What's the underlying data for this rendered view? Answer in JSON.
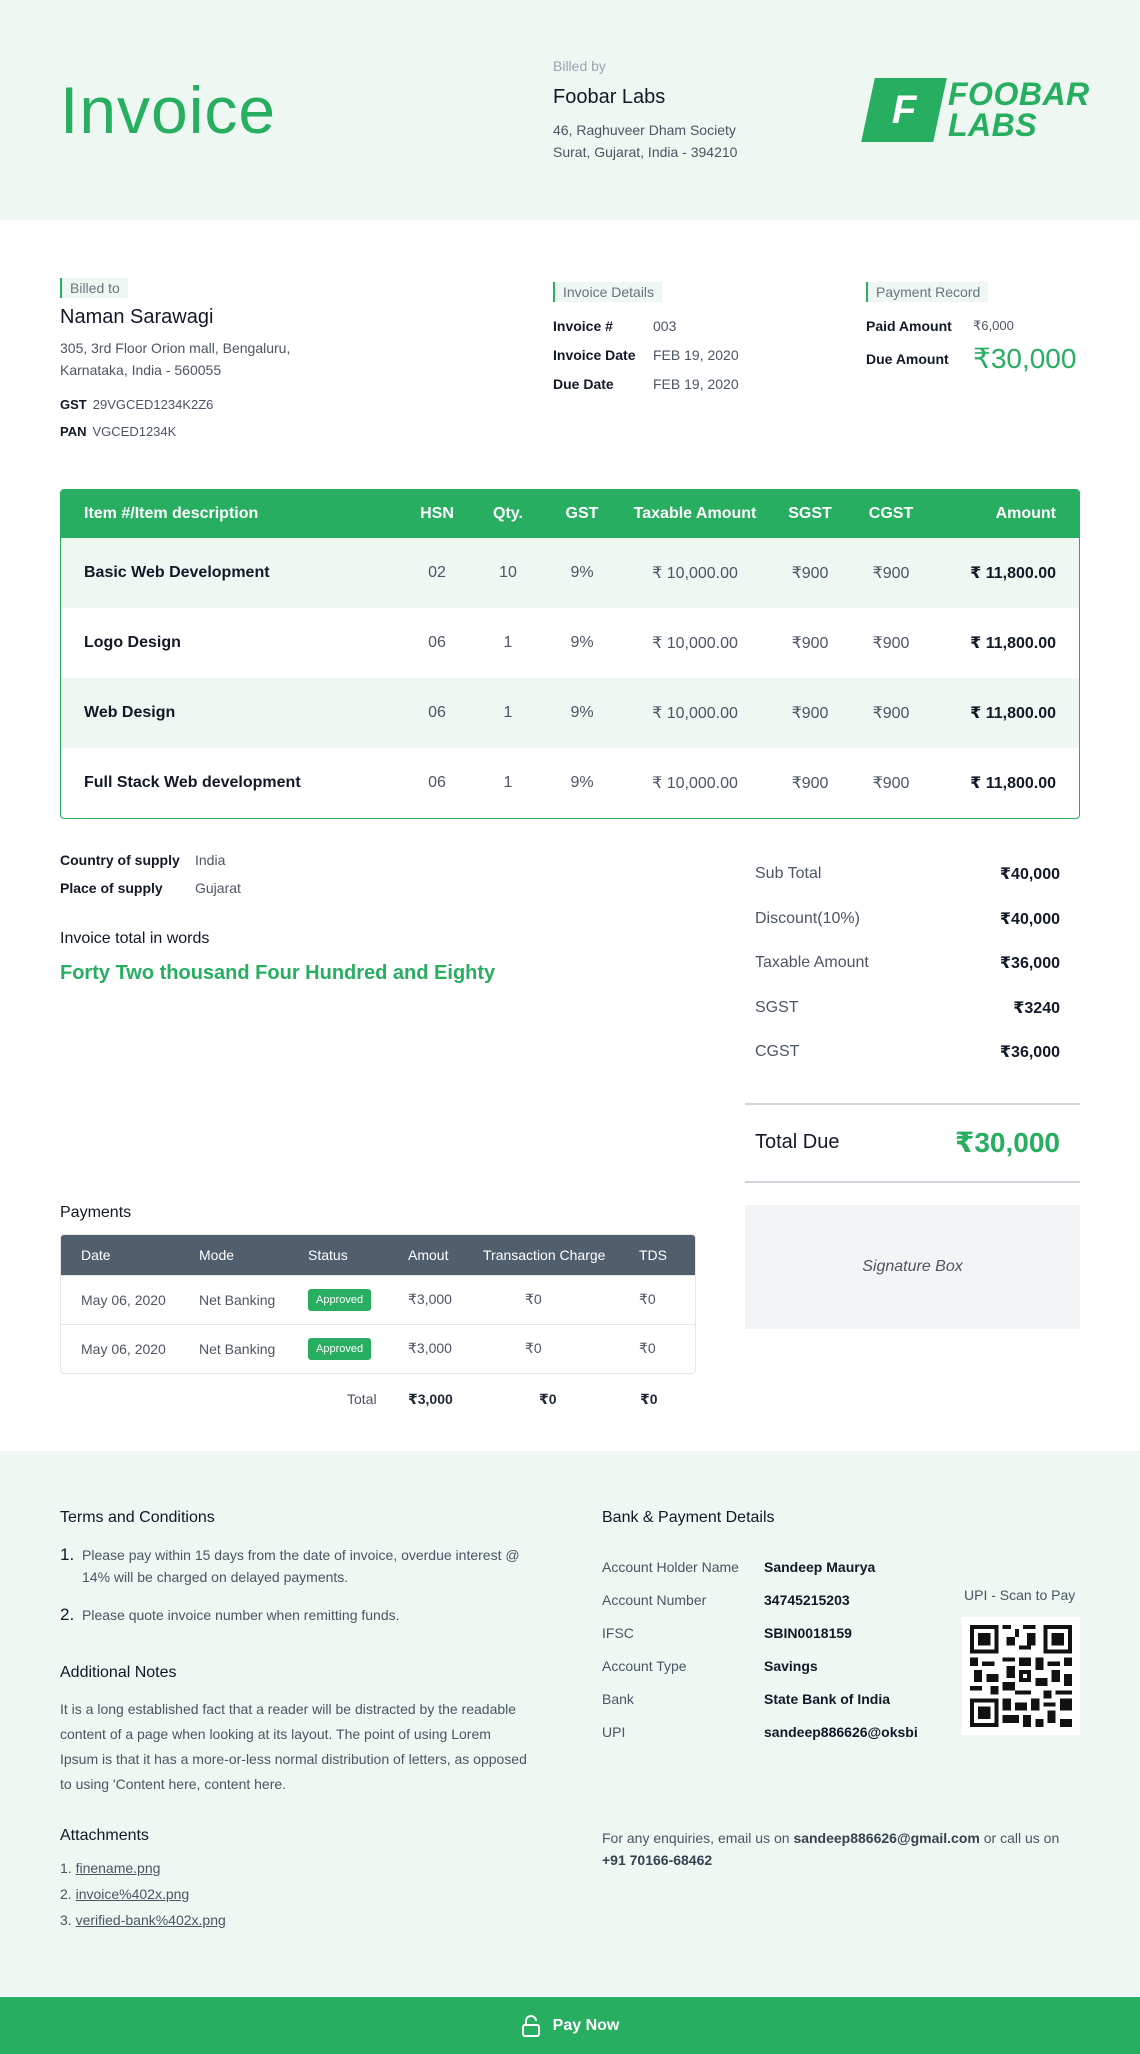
{
  "header": {
    "title": "Invoice",
    "billed_by_label": "Billed by",
    "company": "Foobar Labs",
    "address_line1": "46, Raghuveer Dham Society",
    "address_line2": "Surat, Gujarat, India - 394210",
    "logo_mark": "F",
    "logo_line1": "FOOBAR",
    "logo_line2": "LABS"
  },
  "billed_to": {
    "label": "Billed to",
    "name": "Naman Sarawagi",
    "address_line1": "305, 3rd Floor Orion mall, Bengaluru,",
    "address_line2": "Karnataka, India - 560055",
    "gst_label": "GST",
    "gst": "29VGCED1234K2Z6",
    "pan_label": "PAN",
    "pan": "VGCED1234K"
  },
  "invoice_details": {
    "label": "Invoice Details",
    "number_label": "Invoice #",
    "number": "003",
    "date_label": "Invoice Date",
    "date": "FEB 19, 2020",
    "due_label": "Due Date",
    "due": "FEB 19, 2020"
  },
  "payment_record": {
    "label": "Payment Record",
    "paid_label": "Paid Amount",
    "paid": "₹6,000",
    "due_label": "Due Amount",
    "due": "₹30,000"
  },
  "items": {
    "headers": [
      "Item #/Item description",
      "HSN",
      "Qty.",
      "GST",
      "Taxable Amount",
      "SGST",
      "CGST",
      "Amount"
    ],
    "rows": [
      {
        "desc": "Basic Web Development",
        "hsn": "02",
        "qty": "10",
        "gst": "9%",
        "taxable": "₹ 10,000.00",
        "sgst": "₹900",
        "cgst": "₹900",
        "amount": "₹ 11,800.00"
      },
      {
        "desc": "Logo Design",
        "hsn": "06",
        "qty": "1",
        "gst": "9%",
        "taxable": "₹ 10,000.00",
        "sgst": "₹900",
        "cgst": "₹900",
        "amount": "₹ 11,800.00"
      },
      {
        "desc": "Web Design",
        "hsn": "06",
        "qty": "1",
        "gst": "9%",
        "taxable": "₹ 10,000.00",
        "sgst": "₹900",
        "cgst": "₹900",
        "amount": "₹ 11,800.00"
      },
      {
        "desc": "Full Stack Web development",
        "hsn": "06",
        "qty": "1",
        "gst": "9%",
        "taxable": "₹ 10,000.00",
        "sgst": "₹900",
        "cgst": "₹900",
        "amount": "₹ 11,800.00"
      }
    ]
  },
  "supply": {
    "country_label": "Country of supply",
    "country": "India",
    "place_label": "Place of supply",
    "place": "Gujarat"
  },
  "words": {
    "label": "Invoice total in words",
    "value": "Forty Two thousand Four Hundred and Eighty"
  },
  "totals": {
    "rows": [
      {
        "label": "Sub Total",
        "value": "₹40,000"
      },
      {
        "label": "Discount(10%)",
        "value": "₹40,000"
      },
      {
        "label": "Taxable Amount",
        "value": "₹36,000"
      },
      {
        "label": "SGST",
        "value": "₹3240"
      },
      {
        "label": "CGST",
        "value": "₹36,000"
      }
    ],
    "due_label": "Total Due",
    "due": "₹30,000"
  },
  "payments": {
    "label": "Payments",
    "headers": [
      "Date",
      "Mode",
      "Status",
      "Amout",
      "Transaction Charge",
      "TDS"
    ],
    "rows": [
      {
        "date": "May 06, 2020",
        "mode": "Net Banking",
        "status": "Approved",
        "amount": "₹3,000",
        "charge": "₹0",
        "tds": "₹0"
      },
      {
        "date": "May 06, 2020",
        "mode": "Net Banking",
        "status": "Approved",
        "amount": "₹3,000",
        "charge": "₹0",
        "tds": "₹0"
      }
    ],
    "total_label": "Total",
    "total_amount": "₹3,000",
    "total_charge": "₹0",
    "total_tds": "₹0"
  },
  "signature": "Signature Box",
  "footer": {
    "terms_title": "Terms and Conditions",
    "terms": [
      {
        "n": "1.",
        "text": "Please pay within 15 days from the date of invoice, overdue interest @ 14% will be charged on delayed payments."
      },
      {
        "n": "2.",
        "text": "Please quote invoice number when remitting funds."
      }
    ],
    "notes_title": "Additional Notes",
    "notes": "It is a long established fact that a reader will be distracted by the readable content of a page when looking at its layout. The point of using Lorem Ipsum is that it has a more-or-less normal distribution of letters, as opposed to using 'Content here, content here.",
    "attach_title": "Attachments",
    "attachments": [
      {
        "n": "1.",
        "name": "finename.png"
      },
      {
        "n": "2.",
        "name": "invoice%402x.png"
      },
      {
        "n": "3.",
        "name": "verified-bank%402x.png"
      }
    ],
    "bank_title": "Bank & Payment Details",
    "bank": [
      {
        "label": "Account Holder Name",
        "value": "Sandeep Maurya"
      },
      {
        "label": "Account Number",
        "value": "34745215203"
      },
      {
        "label": "IFSC",
        "value": "SBIN0018159"
      },
      {
        "label": "Account Type",
        "value": "Savings"
      },
      {
        "label": "Bank",
        "value": "State Bank of India"
      },
      {
        "label": "UPI",
        "value": "sandeep886626@oksbi"
      }
    ],
    "upi_label": "UPI - Scan to Pay",
    "enquiry_prefix": "For any enquiries, email us on",
    "enquiry_email": "sandeep886626@gmail.com",
    "enquiry_mid": "or call us on",
    "enquiry_phone": "+91 70166-68462"
  },
  "pay_now": "Pay Now",
  "colors": {
    "accent": "#27ae60",
    "header_bg": "#eef7f2",
    "table_head": "#515e6e"
  }
}
